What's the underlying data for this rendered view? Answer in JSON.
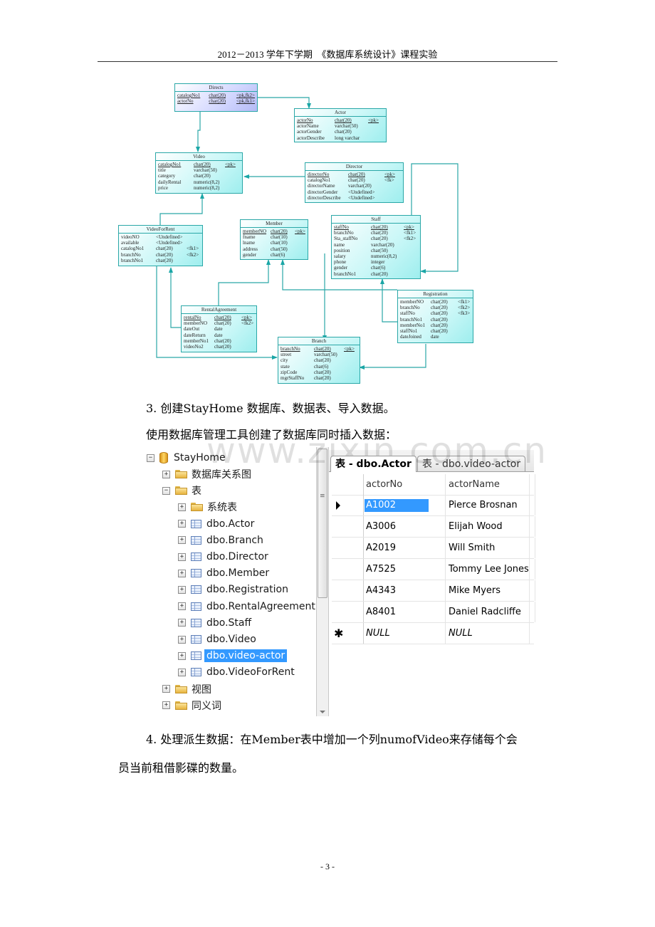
{
  "header": {
    "title": "2012－2013 学年下学期　《数据库系统设计》课程实验"
  },
  "er_diagram": {
    "entities": [
      {
        "key": "directs",
        "name": "Directs",
        "rows": [
          {
            "col": "catalogNo1",
            "type": "char(20)",
            "key": "<pk,fk2>",
            "underline": true
          },
          {
            "col": "actorNo",
            "type": "char(20)",
            "key": "<pk,fk1>",
            "underline": true
          }
        ]
      },
      {
        "key": "actor",
        "name": "Actor",
        "rows": [
          {
            "col": "actorNo",
            "type": "char(20)",
            "key": "<pk>",
            "underline": true
          },
          {
            "col": "actorName",
            "type": "varchar(50)",
            "key": ""
          },
          {
            "col": "actorGender",
            "type": "char(20)",
            "key": ""
          },
          {
            "col": "actorDescribe",
            "type": "long varchar",
            "key": ""
          }
        ]
      },
      {
        "key": "video",
        "name": "Video",
        "rows": [
          {
            "col": "catalogNo1",
            "type": "char(20)",
            "key": "<pk>",
            "underline": true
          },
          {
            "col": "title",
            "type": "varchar(50)",
            "key": ""
          },
          {
            "col": "category",
            "type": "char(20)",
            "key": ""
          },
          {
            "col": "dailyRental",
            "type": "numeric(8,2)",
            "key": ""
          },
          {
            "col": "price",
            "type": "numeric(8,2)",
            "key": ""
          }
        ]
      },
      {
        "key": "director",
        "name": "Director",
        "rows": [
          {
            "col": "directorNo",
            "type": "char(20)",
            "key": "<pk>",
            "underline": true
          },
          {
            "col": "catalogNo1",
            "type": "char(20)",
            "key": "<fk>"
          },
          {
            "col": "directorName",
            "type": "varchar(20)",
            "key": ""
          },
          {
            "col": "directorGender",
            "type": "<Undefined>",
            "key": ""
          },
          {
            "col": "directorDescribe",
            "type": "<Undefined>",
            "key": ""
          }
        ]
      },
      {
        "key": "videoforrent",
        "name": "VideoForRent",
        "rows": [
          {
            "col": "videoNO",
            "type": "<Undefined>",
            "key": ""
          },
          {
            "col": "available",
            "type": "<Undefined>",
            "key": ""
          },
          {
            "col": "catalogNo1",
            "type": "char(20)",
            "key": "<fk1>"
          },
          {
            "col": "branchNo",
            "type": "char(20)",
            "key": "<fk2>"
          },
          {
            "col": "branchNo1",
            "type": "char(20)",
            "key": ""
          }
        ]
      },
      {
        "key": "member",
        "name": "Member",
        "rows": [
          {
            "col": "memberNO",
            "type": "char(20)",
            "key": "<pk>",
            "underline": true
          },
          {
            "col": "fname",
            "type": "char(10)",
            "key": ""
          },
          {
            "col": "lname",
            "type": "char(10)",
            "key": ""
          },
          {
            "col": "address",
            "type": "char(50)",
            "key": ""
          },
          {
            "col": "gender",
            "type": "char(6)",
            "key": ""
          }
        ]
      },
      {
        "key": "staff",
        "name": "Staff",
        "rows": [
          {
            "col": "staffNo",
            "type": "char(20)",
            "key": "<pk>",
            "underline": true
          },
          {
            "col": "branchNo",
            "type": "char(20)",
            "key": "<fk1>"
          },
          {
            "col": "Sta_staffNo",
            "type": "char(20)",
            "key": "<fk2>"
          },
          {
            "col": "name",
            "type": "varchar(20)",
            "key": ""
          },
          {
            "col": "position",
            "type": "char(50)",
            "key": ""
          },
          {
            "col": "salary",
            "type": "numeric(8,2)",
            "key": ""
          },
          {
            "col": "phone",
            "type": "integer",
            "key": ""
          },
          {
            "col": "gender",
            "type": "char(6)",
            "key": ""
          },
          {
            "col": "branchNo1",
            "type": "char(20)",
            "key": ""
          }
        ]
      },
      {
        "key": "registration",
        "name": "Registration",
        "rows": [
          {
            "col": "memberNO",
            "type": "char(20)",
            "key": "<fk1>"
          },
          {
            "col": "branchNo",
            "type": "char(20)",
            "key": "<fk2>"
          },
          {
            "col": "staffNo",
            "type": "char(20)",
            "key": "<fk3>"
          },
          {
            "col": "branchNo1",
            "type": "char(20)",
            "key": ""
          },
          {
            "col": "memberNo1",
            "type": "char(20)",
            "key": ""
          },
          {
            "col": "staffNo1",
            "type": "char(20)",
            "key": ""
          },
          {
            "col": "dateJoined",
            "type": "date",
            "key": ""
          }
        ]
      },
      {
        "key": "rentalagreement",
        "name": "RentalAgreement",
        "rows": [
          {
            "col": "rentalNo",
            "type": "char(20)",
            "key": "<pk>",
            "underline": true
          },
          {
            "col": "memberNO",
            "type": "char(20)",
            "key": "<fk2>"
          },
          {
            "col": "dateOut",
            "type": "date",
            "key": ""
          },
          {
            "col": "dateReturn",
            "type": "date",
            "key": ""
          },
          {
            "col": "memberNo1",
            "type": "char(20)",
            "key": ""
          },
          {
            "col": "videoNo2",
            "type": "char(20)",
            "key": ""
          }
        ]
      },
      {
        "key": "branch",
        "name": "Branch",
        "rows": [
          {
            "col": "branchNo",
            "type": "char(20)",
            "key": "<pk>",
            "underline": true
          },
          {
            "col": "street",
            "type": "varchar(50)",
            "key": ""
          },
          {
            "col": "city",
            "type": "char(20)",
            "key": ""
          },
          {
            "col": "state",
            "type": "char(6)",
            "key": ""
          },
          {
            "col": "zipCode",
            "type": "char(20)",
            "key": ""
          },
          {
            "col": "mgrStaffNo",
            "type": "char(20)",
            "key": ""
          }
        ]
      }
    ],
    "colors": {
      "line": "#2aa7a7",
      "entity_fill": "#c9f7f7",
      "directs_fill": "#d4d8ff"
    }
  },
  "section3": {
    "heading": "3.  创建StayHome 数据库、数据表、导入数据。",
    "description": "使用数据库管理工具创建了数据库同时插入数据："
  },
  "ssms": {
    "tree": {
      "root": "StayHome",
      "items": [
        {
          "label": "数据库关系图",
          "icon": "folder-icon",
          "level": 1,
          "expander": "+"
        },
        {
          "label": "表",
          "icon": "folder-icon",
          "level": 1,
          "expander": "−"
        },
        {
          "label": "系统表",
          "icon": "folder-icon",
          "level": 2,
          "expander": "+"
        },
        {
          "label": "dbo.Actor",
          "icon": "table-icon",
          "level": 2,
          "expander": "+"
        },
        {
          "label": "dbo.Branch",
          "icon": "table-icon",
          "level": 2,
          "expander": "+"
        },
        {
          "label": "dbo.Director",
          "icon": "table-icon",
          "level": 2,
          "expander": "+"
        },
        {
          "label": "dbo.Member",
          "icon": "table-icon",
          "level": 2,
          "expander": "+"
        },
        {
          "label": "dbo.Registration",
          "icon": "table-icon",
          "level": 2,
          "expander": "+"
        },
        {
          "label": "dbo.RentalAgreement",
          "icon": "table-icon",
          "level": 2,
          "expander": "+"
        },
        {
          "label": "dbo.Staff",
          "icon": "table-icon",
          "level": 2,
          "expander": "+"
        },
        {
          "label": "dbo.Video",
          "icon": "table-icon",
          "level": 2,
          "expander": "+"
        },
        {
          "label": "dbo.video-actor",
          "icon": "table-icon",
          "level": 2,
          "expander": "+",
          "selected": true
        },
        {
          "label": "dbo.VideoForRent",
          "icon": "table-icon",
          "level": 2,
          "expander": "+"
        },
        {
          "label": "视图",
          "icon": "folder-icon",
          "level": 1,
          "expander": "+"
        },
        {
          "label": "同义词",
          "icon": "folder-icon",
          "level": 1,
          "expander": "+"
        }
      ],
      "root_expander": "−"
    },
    "tabs": [
      {
        "label": "表 - dbo.Actor",
        "active": true
      },
      {
        "label": "表 - dbo.video-actor",
        "active": false
      }
    ],
    "grid": {
      "columns": [
        "actorNo",
        "actorName"
      ],
      "rows": [
        {
          "actorNo": "A1002",
          "actorName": "Pierce Brosnan",
          "current": true
        },
        {
          "actorNo": "A3006",
          "actorName": "Elijah Wood"
        },
        {
          "actorNo": "A2019",
          "actorName": "Will Smith"
        },
        {
          "actorNo": "A7525",
          "actorName": "Tommy Lee Jones"
        },
        {
          "actorNo": "A4343",
          "actorName": "Mike Myers"
        },
        {
          "actorNo": "A8401",
          "actorName": "Daniel Radcliffe"
        }
      ],
      "new_row": {
        "actorNo": "NULL",
        "actorName": "NULL"
      },
      "selection_color": "#3399ff"
    },
    "watermark": "www.zixin.com.cn"
  },
  "section4": {
    "line1": "4.  处理派生数据：在Member表中增加一个列numofVideo来存储每个会",
    "line2": "员当前租借影碟的数量。"
  },
  "footer": {
    "page_number": "- 3 -"
  }
}
